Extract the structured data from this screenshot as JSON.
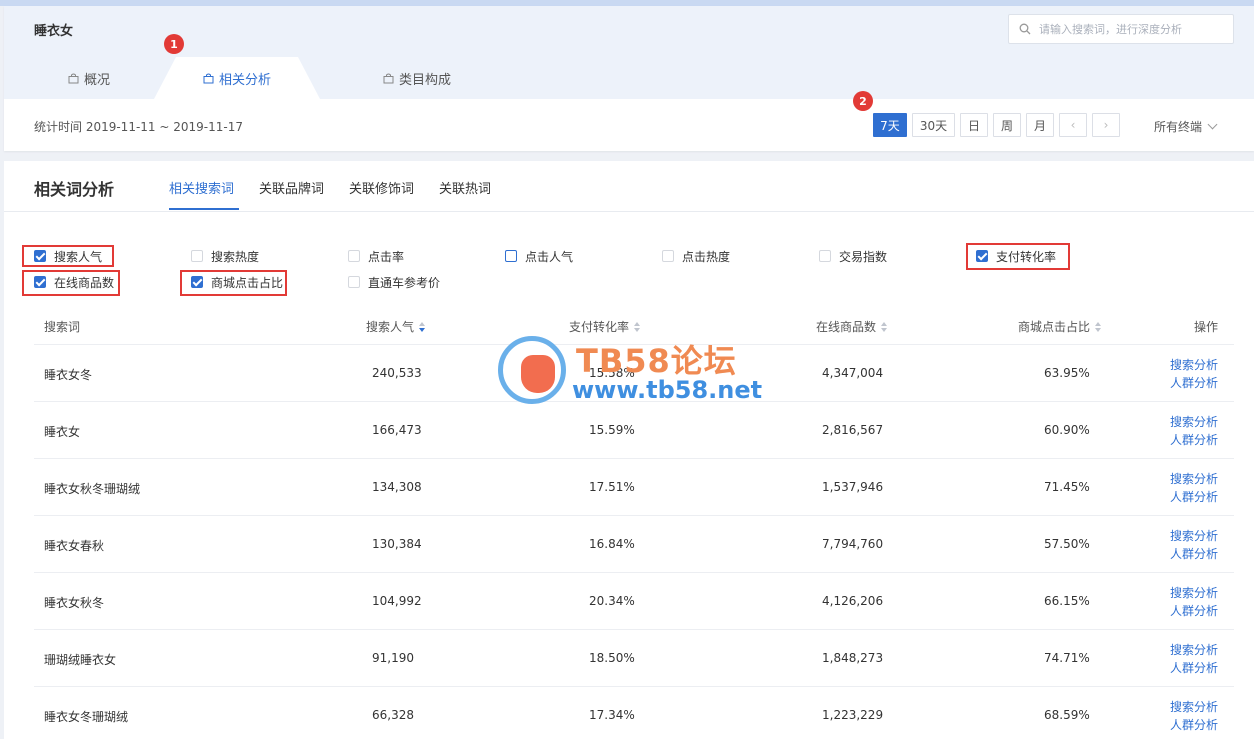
{
  "header": {
    "page_title": "睡衣女",
    "search_placeholder": "请输入搜索词，进行深度分析",
    "tabs": [
      {
        "label": "概况"
      },
      {
        "label": "相关分析"
      },
      {
        "label": "类目构成"
      }
    ],
    "badges": [
      "1",
      "2"
    ],
    "stat_range": "统计时间 2019-11-11 ~ 2019-11-17",
    "periods": [
      "7天",
      "30天",
      "日",
      "周",
      "月"
    ],
    "active_period": "7天",
    "device": "所有终端"
  },
  "main": {
    "title": "相关词分析",
    "sub_tabs": [
      "相关搜索词",
      "关联品牌词",
      "关联修饰词",
      "关联热词"
    ],
    "active_sub_tab": "相关搜索词",
    "checkboxes": [
      {
        "label": "搜索人气",
        "checked": true
      },
      {
        "label": "搜索热度",
        "checked": false
      },
      {
        "label": "点击率",
        "checked": false
      },
      {
        "label": "点击人气",
        "checked": false
      },
      {
        "label": "点击热度",
        "checked": false
      },
      {
        "label": "交易指数",
        "checked": false
      },
      {
        "label": "支付转化率",
        "checked": true
      },
      {
        "label": "在线商品数",
        "checked": true
      },
      {
        "label": "商城点击占比",
        "checked": true
      },
      {
        "label": "直通车参考价",
        "checked": false
      }
    ],
    "table": {
      "headers": [
        "搜索词",
        "搜索人气",
        "支付转化率",
        "在线商品数",
        "商城点击占比",
        "操作"
      ],
      "rows": [
        {
          "word": "睡衣女冬",
          "popularity": "240,533",
          "conversion": "15.58%",
          "products": "4,347,004",
          "mall_ratio": "63.95%"
        },
        {
          "word": "睡衣女",
          "popularity": "166,473",
          "conversion": "15.59%",
          "products": "2,816,567",
          "mall_ratio": "60.90%"
        },
        {
          "word": "睡衣女秋冬珊瑚绒",
          "popularity": "134,308",
          "conversion": "17.51%",
          "products": "1,537,946",
          "mall_ratio": "71.45%"
        },
        {
          "word": "睡衣女春秋",
          "popularity": "130,384",
          "conversion": "16.84%",
          "products": "7,794,760",
          "mall_ratio": "57.50%"
        },
        {
          "word": "睡衣女秋冬",
          "popularity": "104,992",
          "conversion": "20.34%",
          "products": "4,126,206",
          "mall_ratio": "66.15%"
        },
        {
          "word": "珊瑚绒睡衣女",
          "popularity": "91,190",
          "conversion": "18.50%",
          "products": "1,848,273",
          "mall_ratio": "74.71%"
        },
        {
          "word": "睡衣女冬珊瑚绒",
          "popularity": "66,328",
          "conversion": "17.34%",
          "products": "1,223,229",
          "mall_ratio": "68.59%"
        }
      ],
      "action_search": "搜索分析",
      "action_crowd": "人群分析"
    }
  },
  "watermark": {
    "title": "TB58论坛",
    "url": "www.tb58.net"
  }
}
